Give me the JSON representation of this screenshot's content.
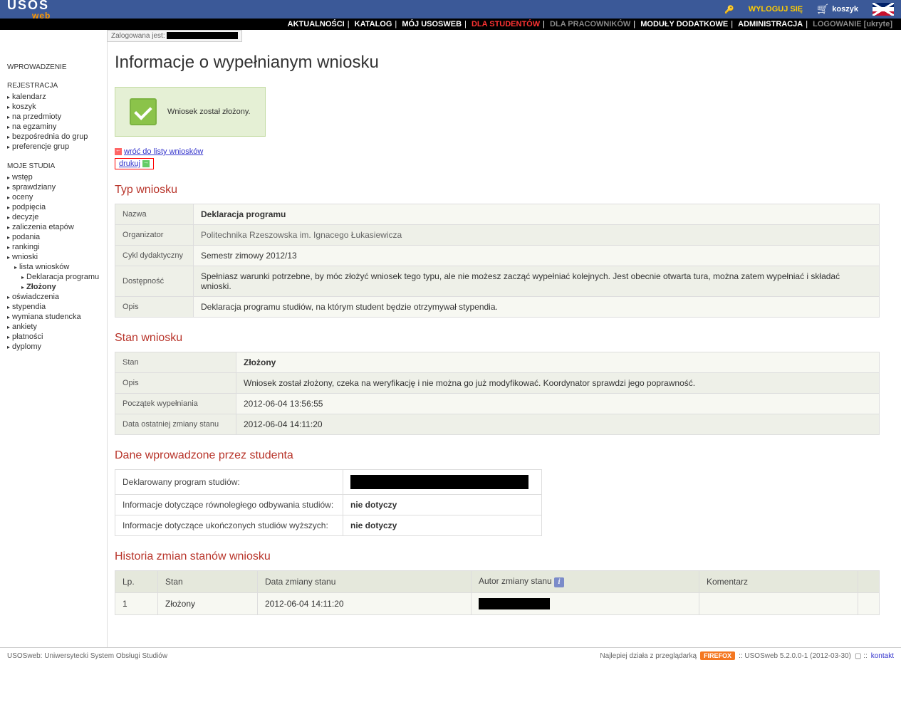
{
  "logo": {
    "l1": "USOS",
    "l2": "web"
  },
  "top": {
    "logout": "WYLOGUJ SIĘ",
    "cart": "koszyk"
  },
  "nav": {
    "aktualnosci": "AKTUALNOŚCI",
    "katalog": "KATALOG",
    "moj": "MÓJ USOSWEB",
    "studentow": "DLA STUDENTÓW",
    "pracownikow": "DLA PRACOWNIKÓW",
    "moduly": "MODUŁY DODATKOWE",
    "admin": "ADMINISTRACJA",
    "logowanie": "LOGOWANIE [ukryte]"
  },
  "login_info": "Zalogowana jest:",
  "sidebar": {
    "h1": "WPROWADZENIE",
    "h2": "REJESTRACJA",
    "h2_items": {
      "i0": "kalendarz",
      "i1": "koszyk",
      "i2": "na przedmioty",
      "i3": "na egzaminy",
      "i4": "bezpośrednia do grup",
      "i5": "preferencje grup"
    },
    "h3": "MOJE STUDIA",
    "h3_items": {
      "i0": "wstęp",
      "i1": "sprawdziany",
      "i2": "oceny",
      "i3": "podpięcia",
      "i4": "decyzje",
      "i5": "zaliczenia etapów",
      "i6": "podania",
      "i7": "rankingi",
      "i8": "wnioski",
      "i8a": "lista wniosków",
      "i8b": "Deklaracja programu",
      "i8c": "Złożony",
      "i9": "oświadczenia",
      "i10": "stypendia",
      "i11": "wymiana studencka",
      "i12": "ankiety",
      "i13": "płatności",
      "i14": "dyplomy"
    }
  },
  "main": {
    "title": "Informacje o wypełnianym wniosku",
    "success": "Wniosek został złożony.",
    "back": "wróć do listy wniosków",
    "print": "drukuj",
    "sec1": "Typ wniosku",
    "type": {
      "r0l": "Nazwa",
      "r0v": "Deklaracja programu",
      "r1l": "Organizator",
      "r1v": "Politechnika Rzeszowska im. Ignacego Łukasiewicza",
      "r2l": "Cykl dydaktyczny",
      "r2v": "Semestr zimowy 2012/13",
      "r3l": "Dostępność",
      "r3v": "Spełniasz warunki potrzebne, by móc złożyć wniosek tego typu, ale nie możesz zacząć wypełniać kolejnych. Jest obecnie otwarta tura, można zatem wypełniać i składać wnioski.",
      "r4l": "Opis",
      "r4v": "Deklaracja programu studiów, na którym student będzie otrzymywał stypendia."
    },
    "sec2": "Stan wniosku",
    "state": {
      "r0l": "Stan",
      "r0v": "Złożony",
      "r1l": "Opis",
      "r1v": "Wniosek został złożony, czeka na weryfikację i nie można go już modyfikować. Koordynator sprawdzi jego poprawność.",
      "r2l": "Początek wypełniania",
      "r2v": "2012-06-04 13:56:55",
      "r3l": "Data ostatniej zmiany stanu",
      "r3v": "2012-06-04 14:11:20"
    },
    "sec3": "Dane wprowadzone przez studenta",
    "student": {
      "r0l": "Deklarowany program studiów:",
      "r1l": "Informacje dotyczące równoległego odbywania studiów:",
      "r1v": "nie dotyczy",
      "r2l": "Informacje dotyczące ukończonych studiów wyższych:",
      "r2v": "nie dotyczy"
    },
    "sec4": "Historia zmian stanów wniosku",
    "history": {
      "h0": "Lp.",
      "h1": "Stan",
      "h2": "Data zmiany stanu",
      "h3": "Autor zmiany stanu",
      "h4": "Komentarz",
      "r0c0": "1",
      "r0c1": "Złożony",
      "r0c2": "2012-06-04 14:11:20"
    }
  },
  "footer": {
    "left": "USOSweb: Uniwersytecki System Obsługi Studiów",
    "browser": "Najlepiej działa z przeglądarką",
    "firefox": "FIREFOX",
    "version": ":: USOSweb 5.2.0.0-1 (2012-03-30)",
    "kontakt": "kontakt"
  }
}
